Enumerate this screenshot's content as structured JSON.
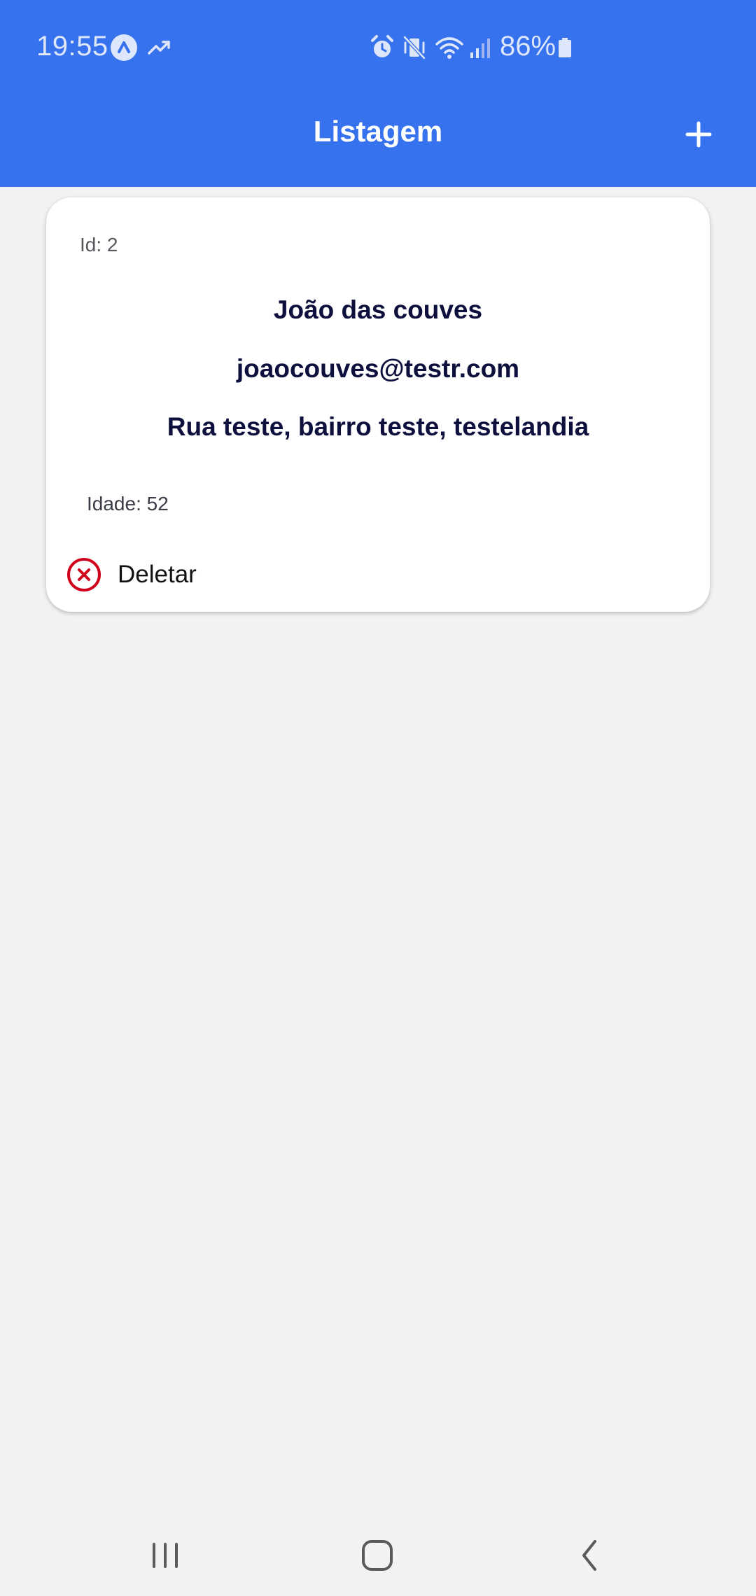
{
  "status_bar": {
    "time": "19:55",
    "battery": "86%"
  },
  "app_bar": {
    "title": "Listagem",
    "add_icon": "plus-icon"
  },
  "records": [
    {
      "id_label": "Id: 2",
      "name": "João das couves",
      "email": "joaocouves@testr.com",
      "address": "Rua teste, bairro teste, testelandia",
      "age_label": "Idade: 52",
      "delete_label": "Deletar"
    }
  ],
  "colors": {
    "primary": "#3671ee",
    "background": "#f2f2f2",
    "card_text": "#0d0f3c",
    "delete_red": "#d0021b"
  },
  "icons": {
    "delete": "close-circle-icon",
    "nav": [
      "recents-icon",
      "home-icon",
      "back-icon"
    ]
  }
}
